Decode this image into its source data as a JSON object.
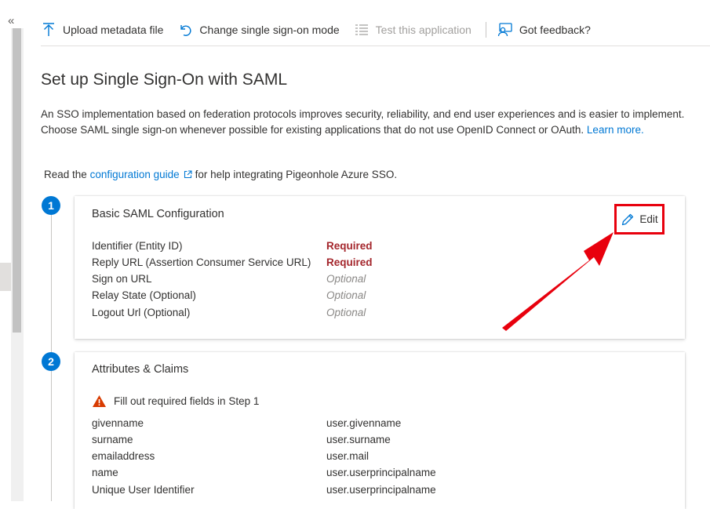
{
  "toolbar": {
    "upload": "Upload metadata file",
    "change_mode": "Change single sign-on mode",
    "test_app": "Test this application",
    "feedback": "Got feedback?"
  },
  "page": {
    "title": "Set up Single Sign-On with SAML",
    "intro": "An SSO implementation based on federation protocols improves security, reliability, and end user experiences and is easier to implement. Choose SAML single sign-on whenever possible for existing applications that do not use OpenID Connect or OAuth.",
    "learn_more": "Learn more.",
    "read_prefix": "Read the",
    "config_guide": "configuration guide",
    "read_suffix": "for help integrating Pigeonhole Azure SSO."
  },
  "step1": {
    "number": "1",
    "title": "Basic SAML Configuration",
    "edit_label": "Edit",
    "rows": [
      {
        "key": "Identifier (Entity ID)",
        "value": "Required",
        "status": "required"
      },
      {
        "key": "Reply URL (Assertion Consumer Service URL)",
        "value": "Required",
        "status": "required"
      },
      {
        "key": "Sign on URL",
        "value": "Optional",
        "status": "optional"
      },
      {
        "key": "Relay State (Optional)",
        "value": "Optional",
        "status": "optional"
      },
      {
        "key": "Logout Url (Optional)",
        "value": "Optional",
        "status": "optional"
      }
    ]
  },
  "step2": {
    "number": "2",
    "title": "Attributes & Claims",
    "warning": "Fill out required fields in Step 1",
    "rows": [
      {
        "key": "givenname",
        "value": "user.givenname"
      },
      {
        "key": "surname",
        "value": "user.surname"
      },
      {
        "key": "emailaddress",
        "value": "user.mail"
      },
      {
        "key": "name",
        "value": "user.userprincipalname"
      },
      {
        "key": "Unique User Identifier",
        "value": "user.userprincipalname"
      }
    ]
  },
  "colors": {
    "accent": "#0078d4",
    "required": "#a4262c",
    "highlight": "#e8000d",
    "warning": "#d83b01"
  },
  "icons": {
    "collapse": "double-chevron-left-icon",
    "upload": "upload-arrow-icon",
    "change_mode": "undo-arrow-icon",
    "test_app": "checklist-icon",
    "feedback": "feedback-person-icon",
    "external_link": "external-link-icon",
    "edit": "pencil-icon",
    "warning": "warning-triangle-icon"
  }
}
